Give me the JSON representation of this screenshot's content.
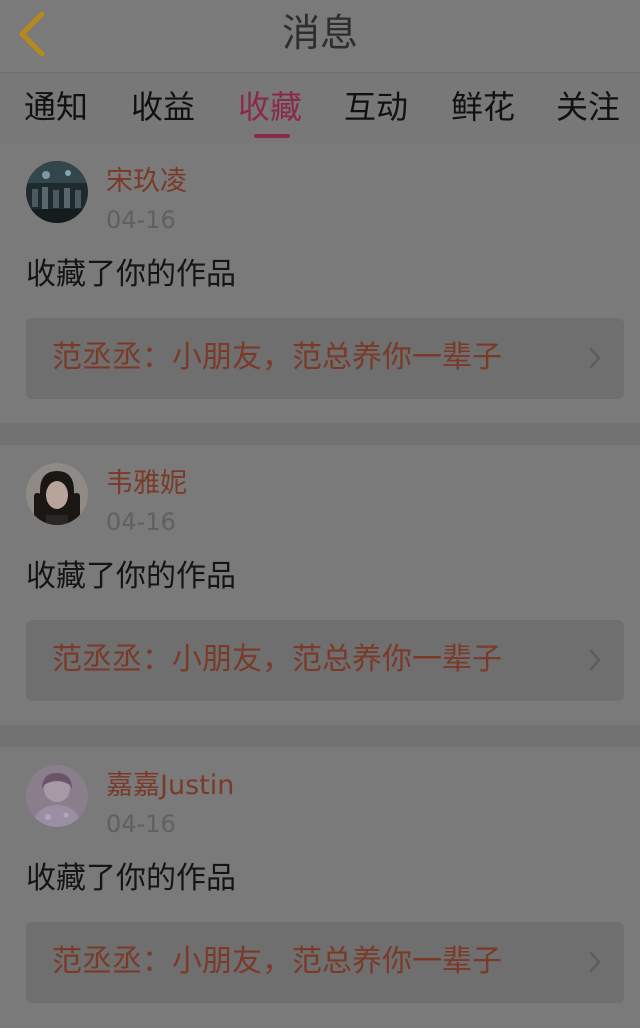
{
  "header": {
    "title": "消息",
    "back_icon": "chevron-left-icon"
  },
  "tabs": [
    {
      "label": "通知"
    },
    {
      "label": "收益"
    },
    {
      "label": "收藏"
    },
    {
      "label": "互动"
    },
    {
      "label": "鲜花"
    },
    {
      "label": "关注"
    }
  ],
  "active_tab": "收藏",
  "colors": {
    "accent": "#8a2a4a",
    "link_text": "#7b3a28",
    "back_icon": "#b58a1a"
  },
  "messages": [
    {
      "user": "宋玖凌",
      "date": "04-16",
      "action": "收藏了你的作品",
      "work": "范丞丞：小朋友，范总养你一辈子"
    },
    {
      "user": "韦雅妮",
      "date": "04-16",
      "action": "收藏了你的作品",
      "work": "范丞丞：小朋友，范总养你一辈子"
    },
    {
      "user": "嘉嘉Justin",
      "date": "04-16",
      "action": "收藏了你的作品",
      "work": "范丞丞：小朋友，范总养你一辈子"
    }
  ]
}
